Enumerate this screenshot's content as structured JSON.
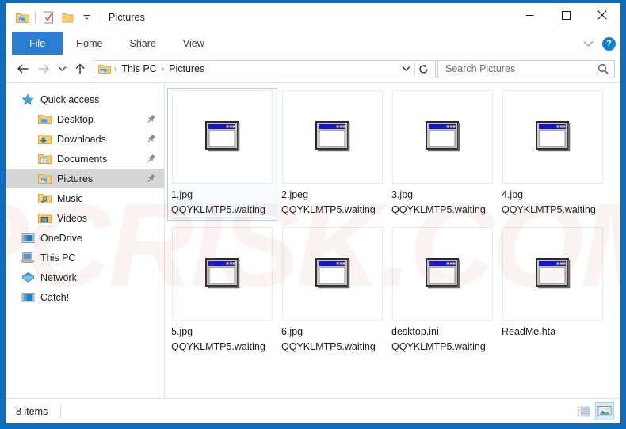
{
  "window": {
    "title": "Pictures",
    "border_color": "#0f6cbd",
    "quick_access": [
      {
        "name": "pictures-folder-icon",
        "label": "Pictures folder"
      },
      {
        "name": "properties-icon",
        "label": "Properties"
      },
      {
        "name": "new-folder-icon",
        "label": "New folder"
      },
      {
        "name": "customize-chevron-icon",
        "label": "Customize Quick Access Toolbar"
      }
    ],
    "controls": {
      "minimize": "—",
      "maximize": "□",
      "close": "✕"
    }
  },
  "ribbon": {
    "accent_color": "#2b7cd3",
    "tabs": [
      {
        "label": "File",
        "active": true
      },
      {
        "label": "Home",
        "active": false
      },
      {
        "label": "Share",
        "active": false
      },
      {
        "label": "View",
        "active": false
      }
    ],
    "expand_icon": "chevron-down-icon",
    "help_label": "?"
  },
  "address": {
    "back_label": "Back",
    "forward_label": "Forward",
    "recent_label": "Recent locations",
    "up_label": "Up",
    "breadcrumbs": [
      "This PC",
      "Pictures"
    ],
    "separator": "›",
    "dropdown_icon": "chevron-down-icon",
    "refresh_icon": "refresh-icon"
  },
  "search": {
    "placeholder": "Search Pictures",
    "value": "",
    "icon": "search-icon"
  },
  "sidebar": {
    "items": [
      {
        "label": "Quick access",
        "icon": "star-icon",
        "level": 0,
        "pinned": false,
        "selected": false
      },
      {
        "label": "Desktop",
        "icon": "desktop-folder-icon",
        "level": 1,
        "pinned": true,
        "selected": false
      },
      {
        "label": "Downloads",
        "icon": "downloads-folder-icon",
        "level": 1,
        "pinned": true,
        "selected": false
      },
      {
        "label": "Documents",
        "icon": "documents-folder-icon",
        "level": 1,
        "pinned": true,
        "selected": false
      },
      {
        "label": "Pictures",
        "icon": "pictures-folder-icon",
        "level": 1,
        "pinned": true,
        "selected": true
      },
      {
        "label": "Music",
        "icon": "music-folder-icon",
        "level": 1,
        "pinned": false,
        "selected": false
      },
      {
        "label": "Videos",
        "icon": "videos-folder-icon",
        "level": 1,
        "pinned": false,
        "selected": false
      },
      {
        "label": "OneDrive",
        "icon": "onedrive-icon",
        "level": 0,
        "pinned": false,
        "selected": false
      },
      {
        "label": "This PC",
        "icon": "this-pc-icon",
        "level": 0,
        "pinned": false,
        "selected": false
      },
      {
        "label": "Network",
        "icon": "network-icon",
        "level": 0,
        "pinned": false,
        "selected": false
      },
      {
        "label": "Catch!",
        "icon": "catch-icon",
        "level": 0,
        "pinned": false,
        "selected": false
      }
    ],
    "selected_bg": "#d6d6d6"
  },
  "files": [
    {
      "name": "1.jpg",
      "suffix": "QQYKLMTP5.waiting",
      "icon": "generic-window-file-icon",
      "selected": true
    },
    {
      "name": "2.jpeg",
      "suffix": "QQYKLMTP5.waiting",
      "icon": "generic-window-file-icon",
      "selected": false
    },
    {
      "name": "3.jpg",
      "suffix": "QQYKLMTP5.waiting",
      "icon": "generic-window-file-icon",
      "selected": false
    },
    {
      "name": "4.jpg",
      "suffix": "QQYKLMTP5.waiting",
      "icon": "generic-window-file-icon",
      "selected": false
    },
    {
      "name": "5.jpg",
      "suffix": "QQYKLMTP5.waiting",
      "icon": "generic-window-file-icon",
      "selected": false
    },
    {
      "name": "6.jpg",
      "suffix": "QQYKLMTP5.waiting",
      "icon": "generic-window-file-icon",
      "selected": false
    },
    {
      "name": "desktop.ini",
      "suffix": "QQYKLMTP5.waiting",
      "icon": "generic-window-file-icon",
      "selected": false
    },
    {
      "name": "ReadMe.hta",
      "suffix": "",
      "icon": "generic-window-file-icon",
      "selected": false
    }
  ],
  "status": {
    "item_count": "8 items",
    "views": [
      {
        "name": "details-view-button",
        "label": "Details view",
        "active": false
      },
      {
        "name": "large-icons-view-button",
        "label": "Large icons view",
        "active": true
      }
    ]
  },
  "watermark": {
    "text": "PCRISK.COM"
  }
}
